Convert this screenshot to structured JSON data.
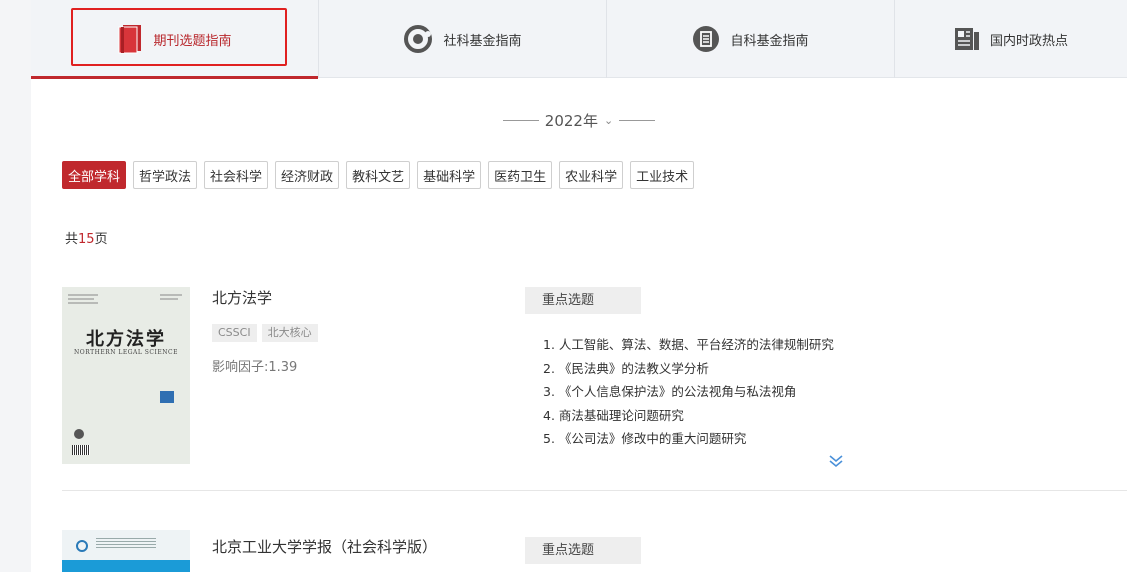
{
  "tabs": [
    {
      "label": "期刊选题指南",
      "icon": "journal-book-icon",
      "active": true
    },
    {
      "label": "社科基金指南",
      "icon": "circle-ring-icon",
      "active": false
    },
    {
      "label": "自科基金指南",
      "icon": "document-circle-icon",
      "active": false
    },
    {
      "label": "国内时政热点",
      "icon": "newspaper-icon",
      "active": false
    }
  ],
  "year": {
    "value": "2022年",
    "chevron": "chevron-down-icon"
  },
  "categories": [
    "全部学科",
    "哲学政法",
    "社会科学",
    "经济财政",
    "教科文艺",
    "基础科学",
    "医药卫生",
    "农业科学",
    "工业技术"
  ],
  "active_category": "全部学科",
  "total": {
    "prefix": "共",
    "count": "15",
    "suffix": "页"
  },
  "journals": [
    {
      "name": "北方法学",
      "tags": [
        "CSSCI",
        "北大核心"
      ],
      "impact": "影响因子:1.39",
      "cover_title": "北方法学",
      "cover_subtitle": "NORTHERN LEGAL SCIENCE",
      "topics_header": "重点选题",
      "topics": [
        "1.  人工智能、算法、数据、平台经济的法律规制研究",
        "2.  《民法典》的法教义学分析",
        "3.  《个人信息保护法》的公法视角与私法视角",
        "4.  商法基础理论问题研究",
        "5.  《公司法》修改中的重大问题研究"
      ]
    },
    {
      "name": "北京工业大学学报（社会科学版）",
      "topics_header": "重点选题"
    }
  ],
  "colors": {
    "accent": "#c0282d",
    "highlight": "#e02020",
    "expand": "#4a90d9"
  }
}
